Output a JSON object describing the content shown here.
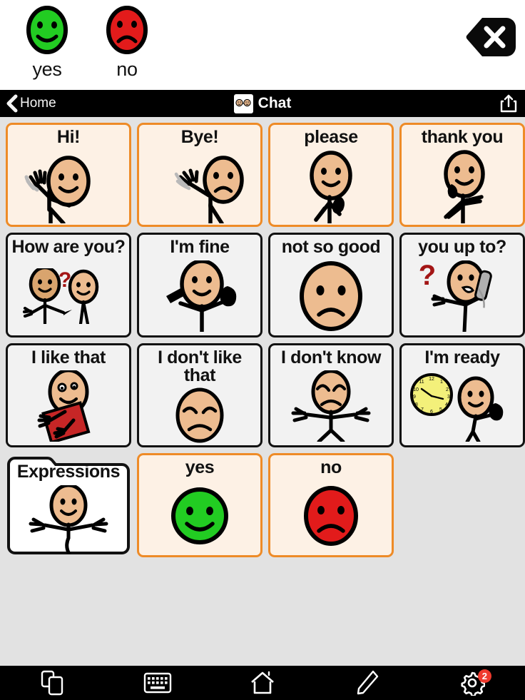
{
  "message_bar": {
    "items": [
      {
        "label": "yes",
        "icon": "green-smiley-face-icon",
        "color": "#22CC22"
      },
      {
        "label": "no",
        "icon": "red-frowny-face-icon",
        "color": "#E21B1B"
      }
    ],
    "backspace_icon": "backspace-delete-icon"
  },
  "navbar": {
    "back_label": "Home",
    "back_icon": "chevron-left-icon",
    "title": "Chat",
    "title_icon": "chat-faces-icon",
    "share_icon": "share-icon"
  },
  "grid": {
    "columns": 4,
    "rows": 4,
    "buttons": [
      {
        "label": "Hi!",
        "style": "accent",
        "icon": "person-waving-icon"
      },
      {
        "label": "Bye!",
        "style": "accent",
        "icon": "person-waving-goodbye-icon"
      },
      {
        "label": "please",
        "style": "accent",
        "icon": "person-please-hands-icon"
      },
      {
        "label": "thank you",
        "style": "accent",
        "icon": "person-thank-you-icon"
      },
      {
        "label": "How are you?",
        "style": "plain",
        "icon": "two-people-question-icon"
      },
      {
        "label": "I'm fine",
        "style": "plain",
        "icon": "person-thumbs-up-icon"
      },
      {
        "label": "not so good",
        "style": "plain",
        "icon": "sad-face-icon"
      },
      {
        "label": "you up to?",
        "style": "plain",
        "icon": "person-phone-question-icon"
      },
      {
        "label": "I like that",
        "style": "plain",
        "icon": "person-holding-red-gift-icon"
      },
      {
        "label": "I don't like that",
        "style": "plain",
        "icon": "unhappy-face-icon"
      },
      {
        "label": "I don't know",
        "style": "plain",
        "icon": "person-shrugging-icon"
      },
      {
        "label": "I'm ready",
        "style": "plain",
        "icon": "clock-and-person-thumbs-up-icon"
      },
      {
        "label": "Expressions",
        "style": "folder",
        "icon": "person-arms-open-icon"
      },
      {
        "label": "yes",
        "style": "accent",
        "icon": "green-smiley-face-icon"
      },
      {
        "label": "no",
        "style": "accent",
        "icon": "red-frowny-face-icon"
      },
      {
        "label": "",
        "style": "empty",
        "icon": ""
      }
    ]
  },
  "toolbar": {
    "items": [
      {
        "name": "pages",
        "icon": "copy-pages-icon",
        "badge": ""
      },
      {
        "name": "keyboard",
        "icon": "keyboard-icon",
        "badge": ""
      },
      {
        "name": "home",
        "icon": "home-icon",
        "badge": ""
      },
      {
        "name": "edit",
        "icon": "pencil-edit-icon",
        "badge": ""
      },
      {
        "name": "settings",
        "icon": "gear-icon",
        "badge": "2"
      }
    ]
  },
  "colors": {
    "accent_border": "#EE8B27",
    "accent_fill": "#FDF1E5",
    "plain_border": "#111111",
    "plain_fill": "#F2F2F2",
    "page_bg": "#E2E2E2",
    "bar_bg": "#000000",
    "badge_bg": "#EF3A2D",
    "skin": "#EDBC90",
    "yes_green": "#22CC22",
    "no_red": "#E21B1B"
  }
}
